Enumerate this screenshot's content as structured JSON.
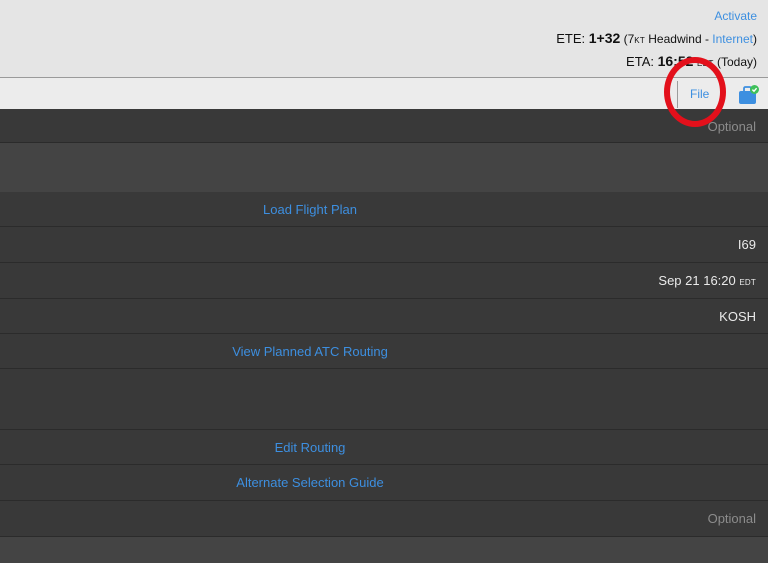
{
  "header": {
    "activate_label": "Activate",
    "ete_label": "ETE: ",
    "ete_value": "1+32",
    "ete_open": " (7",
    "ete_unit": "KT",
    "ete_wind": " Headwind - ",
    "ete_source": "Internet",
    "ete_close": ")",
    "eta_label": "ETA: ",
    "eta_value": "16:52",
    "eta_tz": "EDT",
    "eta_suffix": " (Today)"
  },
  "toolbar": {
    "file_label": "File"
  },
  "form": {
    "optional_top": "Optional",
    "load_flight_plan": "Load Flight Plan",
    "departure": "I69",
    "departure_date": "Sep 21  16:20",
    "departure_tz": "EDT",
    "destination": "KOSH",
    "view_atc_routing": "View Planned ATC Routing",
    "edit_routing": "Edit Routing",
    "alternate_guide": "Alternate Selection Guide",
    "optional_bottom": "Optional"
  },
  "colors": {
    "link": "#3d8fe0",
    "highlight_circle": "#e3101b",
    "status_check": "#3fc05a"
  }
}
